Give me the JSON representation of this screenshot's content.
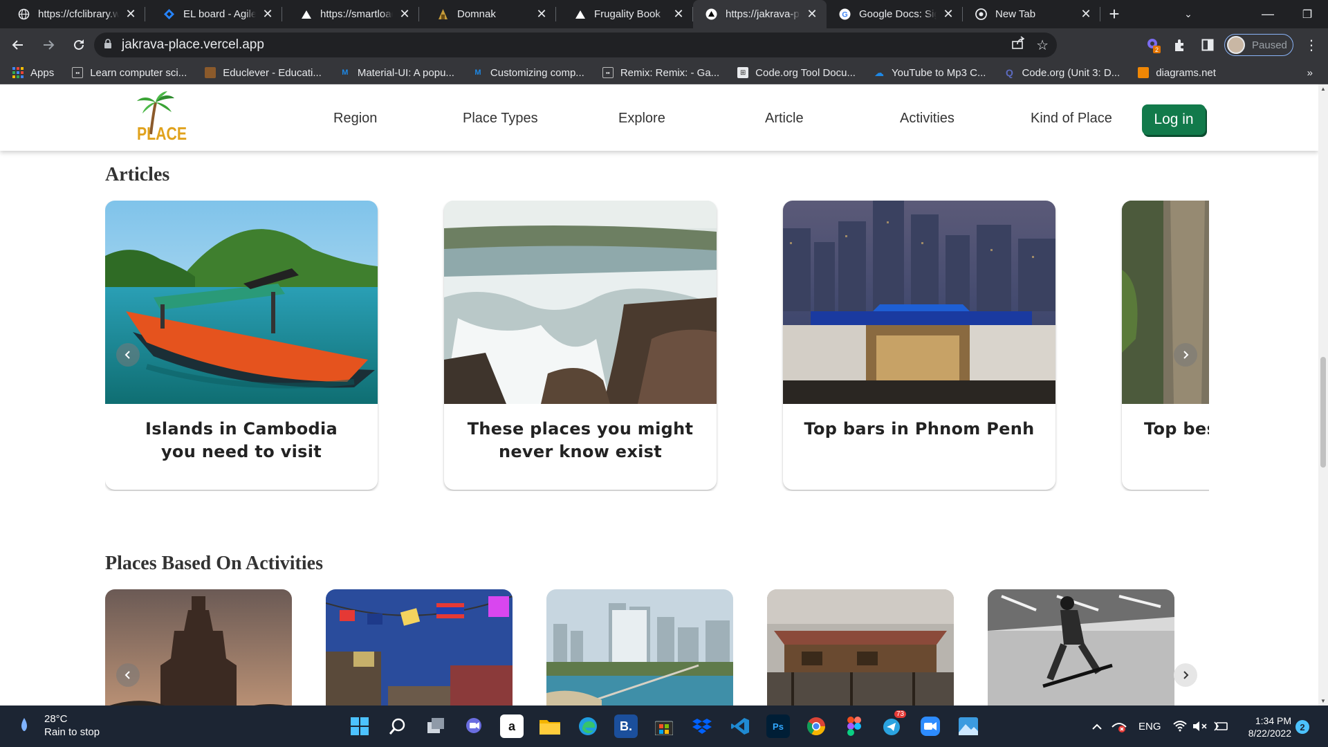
{
  "browser": {
    "tabs": [
      {
        "title": "https://cfclibrary.w",
        "favicon": "globe-icon"
      },
      {
        "title": "EL board - Agile b",
        "favicon": "jira-icon"
      },
      {
        "title": "https://smartload",
        "favicon": "vercel-icon"
      },
      {
        "title": "Domnak",
        "favicon": "domnak-icon"
      },
      {
        "title": "Frugality Book",
        "favicon": "vercel-icon"
      },
      {
        "title": "https://jakrava-pl",
        "favicon": "vercel-icon",
        "active": true
      },
      {
        "title": "Google Docs: Sign",
        "favicon": "google-icon"
      },
      {
        "title": "New Tab",
        "favicon": "chrome-icon"
      }
    ],
    "url": "jakrava-place.vercel.app",
    "profile_label": "Paused",
    "extension_badge": "2",
    "bookmarks": [
      {
        "label": "Apps",
        "color": "#4285f4"
      },
      {
        "label": "Learn computer sci...",
        "color": "#555555"
      },
      {
        "label": "Educlever - Educati...",
        "color": "#8b5a2b"
      },
      {
        "label": "Material-UI: A popu...",
        "color": "#1976d2"
      },
      {
        "label": "Customizing comp...",
        "color": "#1976d2"
      },
      {
        "label": "Remix: Remix: - Ga...",
        "color": "#555555"
      },
      {
        "label": "Code.org Tool Docu...",
        "color": "#e8eaed"
      },
      {
        "label": "YouTube to Mp3 C...",
        "color": "#1e88e5"
      },
      {
        "label": "Code.org (Unit 3: D...",
        "color": "#3f51b5"
      },
      {
        "label": "diagrams.net",
        "color": "#f08705"
      }
    ],
    "bookmarks_more": "»"
  },
  "site": {
    "logo_text": "PLACE",
    "nav": [
      "Region",
      "Place Types",
      "Explore",
      "Article",
      "Activities",
      "Kind of Place"
    ],
    "login_label": "Log in",
    "accent_color": "#127a4b"
  },
  "articles": {
    "title": "Articles",
    "items": [
      {
        "caption": "Islands in Cambodia you need to visit"
      },
      {
        "caption": "These places you might never know exist"
      },
      {
        "caption": "Top bars in Phnom Penh"
      },
      {
        "caption": "Top bes"
      }
    ]
  },
  "activities": {
    "title": "Places Based On Activities"
  },
  "taskbar": {
    "temperature": "28°C",
    "weather": "Rain to stop",
    "language": "ENG",
    "time": "1:34 PM",
    "date": "8/22/2022",
    "notifications": "2",
    "telegram_badge": "73"
  }
}
